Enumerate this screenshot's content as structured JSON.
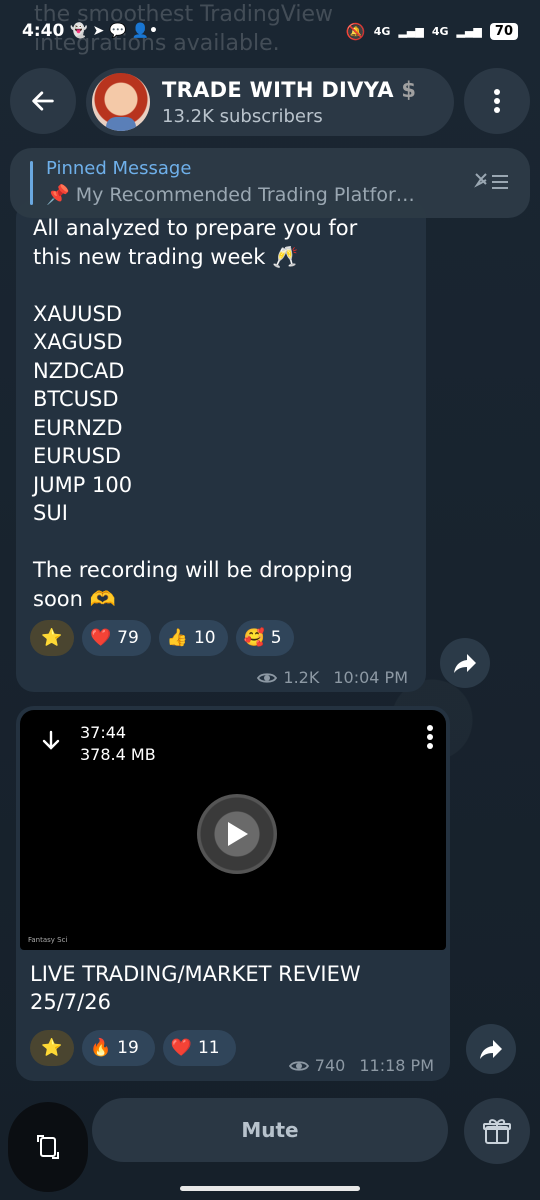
{
  "status": {
    "time": "4:40",
    "network1": "4G",
    "network2": "4G",
    "battery": "70"
  },
  "ghost": {
    "text": "the smoothest TradingView\nintegrations available."
  },
  "header": {
    "channel_name": "TRADE WITH DIVYA",
    "channel_suffix": "$",
    "subscribers": "13.2K subscribers"
  },
  "pinned": {
    "title": "Pinned Message",
    "message": "📌 My Recommended Trading Platfor…"
  },
  "messages": [
    {
      "text": "All analyzed to prepare you for\nthis new trading week 🥂\n\nXAUUSD\nXAGUSD\nNZDCAD\nBTCUSD\nEURNZD\nEURUSD\nJUMP 100\nSUI\n\nThe recording will be dropping\nsoon 🫶",
      "reactions": [
        {
          "emoji": "⭐",
          "count": ""
        },
        {
          "emoji": "❤️",
          "count": "79"
        },
        {
          "emoji": "👍",
          "count": "10"
        },
        {
          "emoji": "🥰",
          "count": "5"
        }
      ],
      "views": "1.2K",
      "time": "10:04 PM"
    },
    {
      "video_duration": "37:44",
      "video_size": "378.4 MB",
      "video_watermark": "Fantasy Sci",
      "caption": "LIVE TRADING/MARKET REVIEW\n25/7/26",
      "reactions": [
        {
          "emoji": "⭐",
          "count": ""
        },
        {
          "emoji": "🔥",
          "count": "19"
        },
        {
          "emoji": "❤️",
          "count": "11"
        }
      ],
      "views": "740",
      "time": "11:18 PM"
    }
  ],
  "bottom": {
    "mute_label": "Mute"
  }
}
